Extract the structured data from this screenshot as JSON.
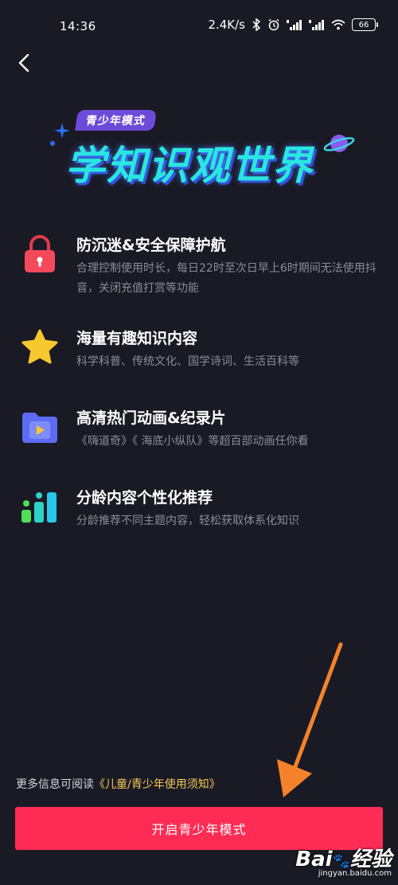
{
  "status_bar": {
    "time": "14:36",
    "network_speed": "2.4K/s",
    "battery": "66",
    "icons": [
      "bluetooth-icon",
      "alarm-icon",
      "signal-hd-icon",
      "signal-hd-icon",
      "wifi-icon",
      "battery-icon"
    ]
  },
  "header": {
    "back_icon": "chevron-left-icon"
  },
  "hero": {
    "badge": "青少年模式",
    "title": "学知识观世界",
    "accent_color": "#29e6e0",
    "badge_color": "#6c4bd9"
  },
  "features": [
    {
      "icon": "lock-icon",
      "title": "防沉迷&安全保障护航",
      "desc": "合理控制使用时长，每日22时至次日早上6时期间无法使用抖音，关闭充值打赏等功能"
    },
    {
      "icon": "star-icon",
      "title": "海量有趣知识内容",
      "desc": "科学科普、传统文化、国学诗词、生活百科等"
    },
    {
      "icon": "video-folder-icon",
      "title": "高清热门动画&纪录片",
      "desc": "《嗨道奇》《 海底小纵队》等超百部动画任你看"
    },
    {
      "icon": "bar-chart-icon",
      "title": "分龄内容个性化推荐",
      "desc": "分龄推荐不同主题内容，轻松获取体系化知识"
    }
  ],
  "footer": {
    "notice_prefix": "更多信息可阅读",
    "notice_link": "《儿童/青少年使用须知》",
    "button_label": "开启青少年模式",
    "button_color": "#fe2c55",
    "link_color": "#f3c75b"
  },
  "watermark": {
    "logo": "Bai",
    "logo_suffix": "经验",
    "url": "jingyan.baidu.com"
  }
}
